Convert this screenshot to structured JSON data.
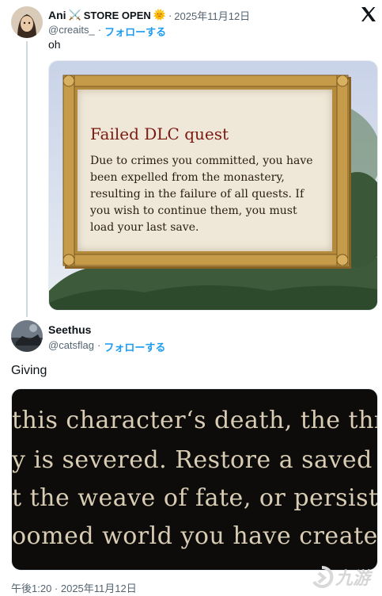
{
  "tweet1": {
    "name": "Ani",
    "swords": "⚔️",
    "store": "STORE OPEN",
    "sun": "🌞",
    "dot": "·",
    "date": "2025年11月12日",
    "handle": "@creaits_",
    "sep": "·",
    "follow": "フォローする",
    "text": "oh",
    "image": {
      "title": "Failed DLC quest",
      "body": "Due to crimes you committed, you have been expelled from the monastery, resulting in the failure of all quests. If you wish to continue them, you must load your last save."
    }
  },
  "tweet2": {
    "name": "Seethus",
    "handle": "@catsflag",
    "sep": "·",
    "follow": "フォローする",
    "text": "Giving",
    "image": {
      "lines": [
        "this character‘s death, the thr",
        "y is severed. Restore a saved g",
        "t the weave of fate, or persist",
        "oomed world you have created"
      ]
    },
    "timestamp": "午後1:20 · 2025年11月12日"
  },
  "x_logo": "𝕏",
  "watermark": "九游"
}
